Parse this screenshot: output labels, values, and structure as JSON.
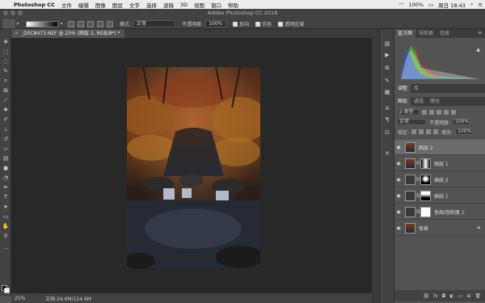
{
  "menubar": {
    "app": "Photoshop CC",
    "items": [
      "文件",
      "编辑",
      "图像",
      "图层",
      "文字",
      "选择",
      "滤镜",
      "3D",
      "视图",
      "窗口",
      "帮助"
    ],
    "battery": "100%",
    "clock": "周日 18:43"
  },
  "window": {
    "title": "Adobe Photoshop CC 2018"
  },
  "options": {
    "mode_label": "模式:",
    "mode_value": "正常",
    "opacity_label": "不透明度:",
    "opacity_value": "100%",
    "reverse_label": "反向",
    "dither_label": "仿色",
    "transparency_label": "透明区域"
  },
  "document": {
    "tab_title": "_DSC8473.NEF @ 25% (图层 2, RGB/8*) *",
    "tab_close": "×"
  },
  "status": {
    "zoom": "25%",
    "doc_size": "文档:34.6M/124.6M"
  },
  "panels": {
    "histogram_tabs": [
      "直方图",
      "导航器",
      "信息"
    ],
    "adjust_tabs": [
      "调整",
      "库"
    ],
    "layer_tabs": [
      "图层",
      "通道",
      "路径"
    ]
  },
  "layers_panel": {
    "filter_label": "ρ 类型",
    "blend_mode": "正常",
    "opacity_label": "不透明度:",
    "opacity_value": "100%",
    "lock_label": "锁定:",
    "fill_label": "填充:",
    "fill_value": "100%",
    "layers": [
      {
        "name": "图层 2",
        "selected": true
      },
      {
        "name": "图层 1",
        "selected": false
      },
      {
        "name": "曲线 2",
        "selected": false
      },
      {
        "name": "曲线 1",
        "selected": false
      },
      {
        "name": "色相/饱和度 1",
        "selected": false
      },
      {
        "name": "背景",
        "selected": false
      }
    ]
  },
  "colors": {
    "accent": "#4a90d9",
    "ui_dark": "#424242",
    "canvas_bg": "#282828",
    "selected_layer": "#6b6b6b"
  }
}
